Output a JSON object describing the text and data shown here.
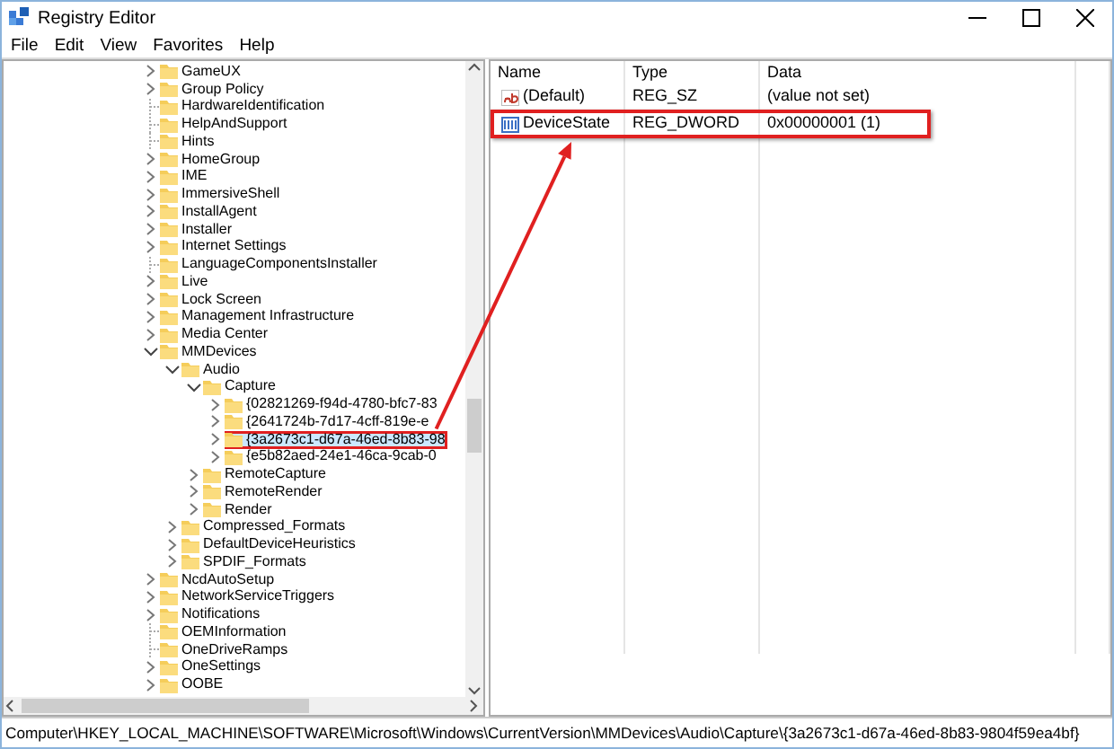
{
  "window": {
    "title": "Registry Editor"
  },
  "menu": [
    "File",
    "Edit",
    "View",
    "Favorites",
    "Help"
  ],
  "tree": [
    {
      "label": "GameUX",
      "expandable": true,
      "selected": false
    },
    {
      "label": "Group Policy",
      "expandable": true,
      "selected": false
    },
    {
      "label": "HardwareIdentification",
      "expandable": false,
      "selected": false
    },
    {
      "label": "HelpAndSupport",
      "expandable": false,
      "selected": false
    },
    {
      "label": "Hints",
      "expandable": false,
      "selected": false
    },
    {
      "label": "HomeGroup",
      "expandable": true,
      "selected": false
    },
    {
      "label": "IME",
      "expandable": true,
      "selected": false
    },
    {
      "label": "ImmersiveShell",
      "expandable": true,
      "selected": false
    },
    {
      "label": "InstallAgent",
      "expandable": true,
      "selected": false
    },
    {
      "label": "Installer",
      "expandable": true,
      "selected": false
    },
    {
      "label": "Internet Settings",
      "expandable": true,
      "selected": false
    },
    {
      "label": "LanguageComponentsInstaller",
      "expandable": false,
      "selected": false
    },
    {
      "label": "Live",
      "expandable": true,
      "selected": false
    },
    {
      "label": "Lock Screen",
      "expandable": true,
      "selected": false
    },
    {
      "label": "Management Infrastructure",
      "expandable": true,
      "selected": false
    },
    {
      "label": "Media Center",
      "expandable": true,
      "selected": false
    },
    {
      "label": "MMDevices",
      "expandable": true,
      "expanded": true,
      "selected": false,
      "children": [
        {
          "label": "Audio",
          "expandable": true,
          "expanded": true,
          "selected": false,
          "children": [
            {
              "label": "Capture",
              "expandable": true,
              "expanded": true,
              "selected": false,
              "children": [
                {
                  "label": "{02821269-f94d-4780-bfc7-83",
                  "expandable": true,
                  "selected": false
                },
                {
                  "label": "{2641724b-7d17-4cff-819e-e",
                  "expandable": true,
                  "selected": false
                },
                {
                  "label": "{3a2673c1-d67a-46ed-8b83-98",
                  "expandable": true,
                  "selected": true,
                  "boxed": true
                },
                {
                  "label": "{e5b82aed-24e1-46ca-9cab-0",
                  "expandable": true,
                  "selected": false
                }
              ]
            },
            {
              "label": "RemoteCapture",
              "expandable": true,
              "selected": false
            },
            {
              "label": "RemoteRender",
              "expandable": true,
              "selected": false
            },
            {
              "label": "Render",
              "expandable": true,
              "selected": false
            }
          ]
        },
        {
          "label": "Compressed_Formats",
          "expandable": true,
          "selected": false
        },
        {
          "label": "DefaultDeviceHeuristics",
          "expandable": true,
          "selected": false
        },
        {
          "label": "SPDIF_Formats",
          "expandable": true,
          "selected": false
        }
      ]
    },
    {
      "label": "NcdAutoSetup",
      "expandable": true,
      "selected": false
    },
    {
      "label": "NetworkServiceTriggers",
      "expandable": true,
      "selected": false
    },
    {
      "label": "Notifications",
      "expandable": true,
      "selected": false
    },
    {
      "label": "OEMInformation",
      "expandable": false,
      "selected": false
    },
    {
      "label": "OneDriveRamps",
      "expandable": false,
      "selected": false
    },
    {
      "label": "OneSettings",
      "expandable": true,
      "selected": false
    },
    {
      "label": "OOBE",
      "expandable": true,
      "selected": false
    }
  ],
  "values": {
    "columns": [
      "Name",
      "Type",
      "Data"
    ],
    "rows": [
      {
        "kind": "string",
        "name": "(Default)",
        "type": "REG_SZ",
        "data": "(value not set)"
      },
      {
        "kind": "binary",
        "name": "DeviceState",
        "type": "REG_DWORD",
        "data": "0x00000001 (1)",
        "boxed": true
      }
    ]
  },
  "callout_arrow": true,
  "status_bar": "Computer\\HKEY_LOCAL_MACHINE\\SOFTWARE\\Microsoft\\Windows\\CurrentVersion\\MMDevices\\Audio\\Capture\\{3a2673c1-d67a-46ed-8b83-9804f59ea4bf}"
}
